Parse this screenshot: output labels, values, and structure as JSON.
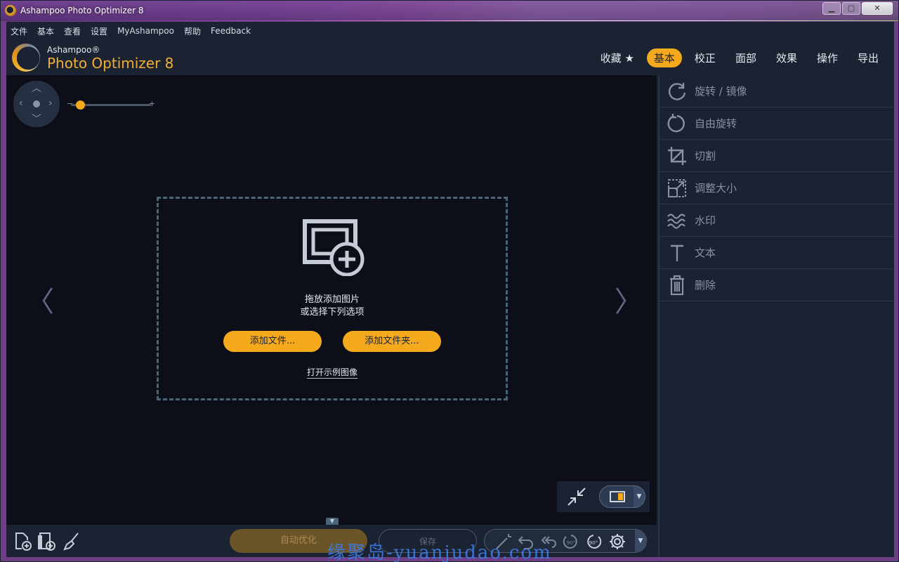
{
  "window": {
    "title": "Ashampoo Photo Optimizer 8"
  },
  "menu": [
    "文件",
    "基本",
    "查看",
    "设置",
    "MyAshampoo",
    "帮助",
    "Feedback"
  ],
  "brand": {
    "small": "Ashampoo®",
    "big": "Photo Optimizer 8"
  },
  "tabs": [
    {
      "label": "收藏 ★",
      "active": false
    },
    {
      "label": "基本",
      "active": true
    },
    {
      "label": "校正",
      "active": false
    },
    {
      "label": "面部",
      "active": false
    },
    {
      "label": "效果",
      "active": false
    },
    {
      "label": "操作",
      "active": false
    },
    {
      "label": "导出",
      "active": false
    }
  ],
  "canvas": {
    "zoom_level": 0.12,
    "drop_line1": "拖放添加图片",
    "drop_line2": "或选择下列选项",
    "add_files": "添加文件...",
    "add_folder": "添加文件夹...",
    "open_sample": "打开示例图像"
  },
  "bottom": {
    "auto_optimize": "自动优化",
    "save": "保存"
  },
  "right_panel": [
    {
      "label": "旋转 / 镜像",
      "icon": "rotate-mirror-icon"
    },
    {
      "label": "自由旋转",
      "icon": "free-rotate-icon"
    },
    {
      "label": "切割",
      "icon": "crop-icon"
    },
    {
      "label": "调整大小",
      "icon": "resize-icon"
    },
    {
      "label": "水印",
      "icon": "watermark-icon"
    },
    {
      "label": "文本",
      "icon": "text-icon"
    },
    {
      "label": "删除",
      "icon": "trash-icon"
    }
  ],
  "watermark_text": "缘聚岛-yuanjudao.com",
  "colors": {
    "accent": "#f5a91c",
    "panel": "#1b2232",
    "canvas": "#0c0f18"
  }
}
